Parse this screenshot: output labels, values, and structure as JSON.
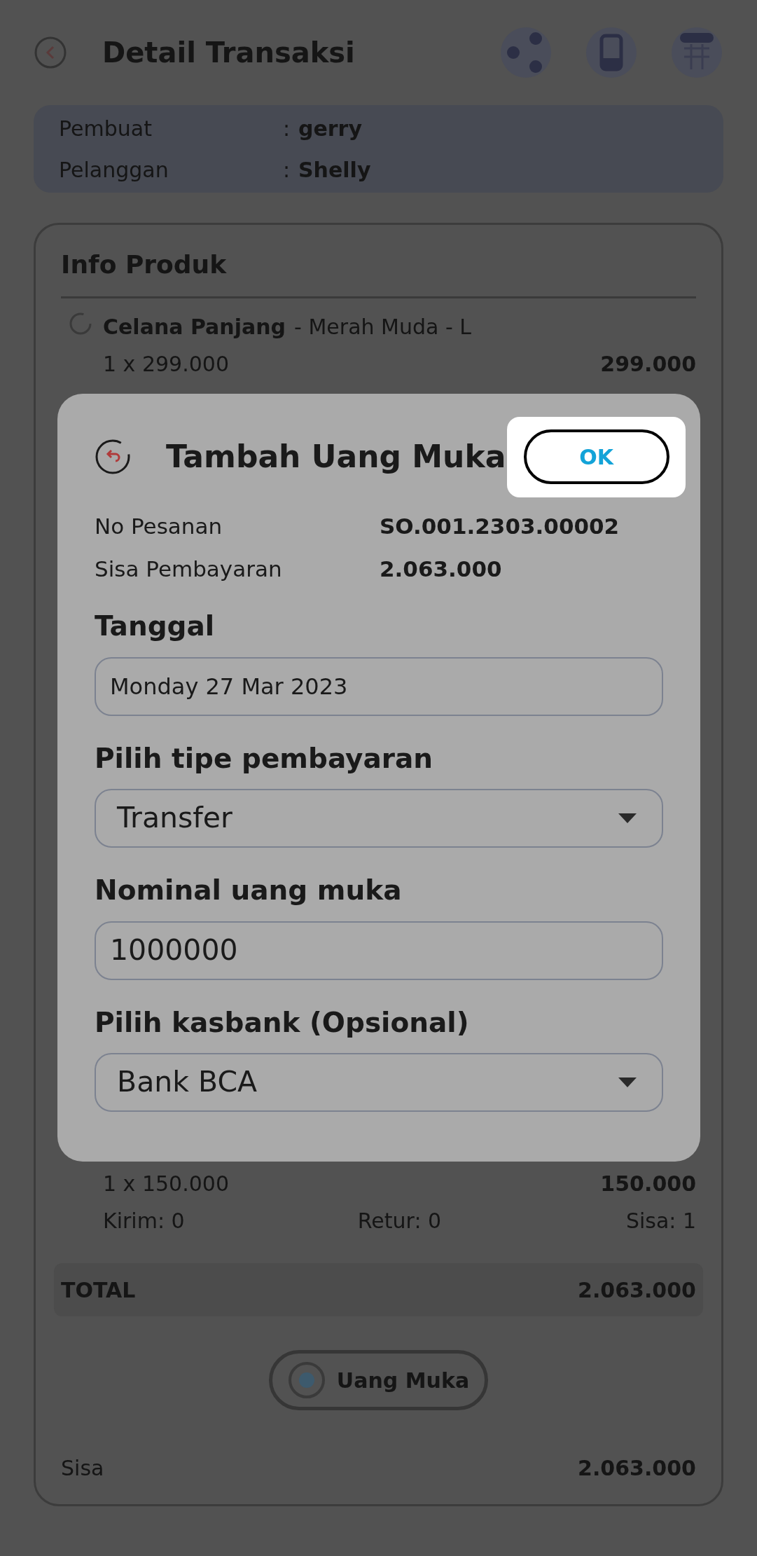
{
  "header": {
    "title": "Detail Transaksi"
  },
  "info": [
    {
      "label": "Pembuat",
      "separator": ":",
      "value": "gerry"
    },
    {
      "label": "Pelanggan",
      "separator": ":",
      "value": "Shelly"
    }
  ],
  "product_card": {
    "title": "Info Produk",
    "items": [
      {
        "name": "Celana Panjang",
        "variant": "- Merah Muda - L",
        "qty_price": "1 x 299.000",
        "amount": "299.000"
      },
      {
        "qty_price": "1 x 150.000",
        "amount": "150.000",
        "kirim": "Kirim: 0",
        "retur": "Retur: 0",
        "sisa": "Sisa: 1"
      }
    ],
    "total_label": "TOTAL",
    "total_value": "2.063.000",
    "action_button": "Uang Muka",
    "sisa_label": "Sisa",
    "sisa_value": "2.063.000"
  },
  "dialog": {
    "title": "Tambah Uang Muka",
    "ok_button": "OK",
    "summary": [
      {
        "label": "No Pesanan",
        "value": "SO.001.2303.00002"
      },
      {
        "label": "Sisa Pembayaran",
        "value": "2.063.000"
      }
    ],
    "fields": [
      {
        "label": "Tanggal",
        "kind": "date",
        "value": "Monday 27 Mar 2023"
      },
      {
        "label": "Pilih tipe pembayaran",
        "kind": "dropdown",
        "value": "Transfer"
      },
      {
        "label": "Nominal uang muka",
        "kind": "text",
        "value": "1000000"
      },
      {
        "label": "Pilih kasbank (Opsional)",
        "kind": "dropdown",
        "value": "Bank BCA"
      }
    ]
  }
}
